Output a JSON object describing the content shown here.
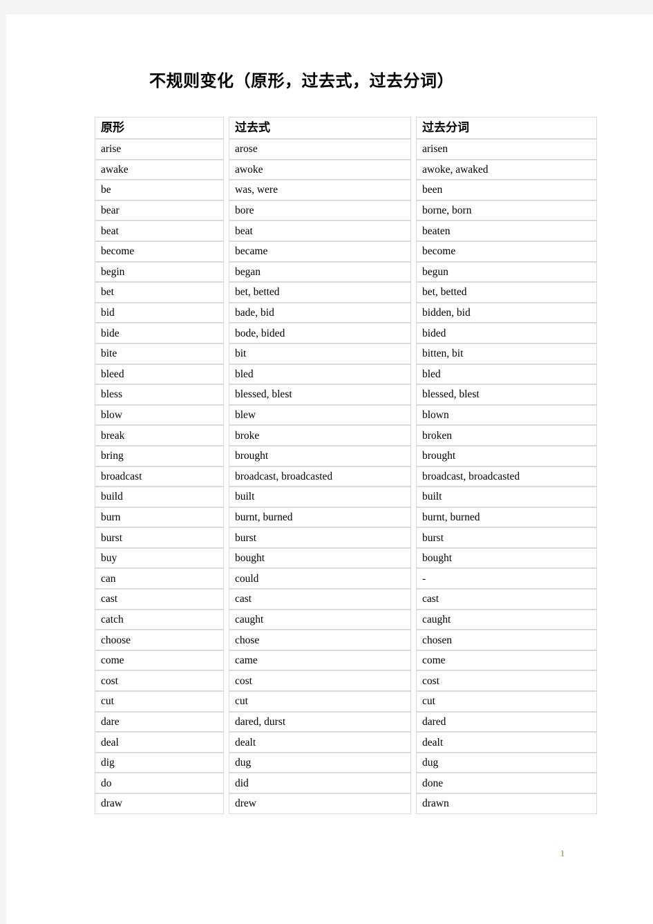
{
  "document": {
    "title": "不规则变化（原形，过去式，过去分词）",
    "page_number": "1",
    "page_number_color": "#9a8020",
    "background_color": "#f4f4f4",
    "page_color": "#ffffff",
    "border_color": "#d9d9d9"
  },
  "table": {
    "headers": [
      "原形",
      "过去式",
      "过去分词"
    ],
    "rows": [
      [
        "arise",
        "arose",
        "arisen"
      ],
      [
        "awake",
        "awoke",
        "awoke, awaked"
      ],
      [
        "be",
        "was, were",
        "been"
      ],
      [
        "bear",
        "bore",
        "borne, born"
      ],
      [
        "beat",
        "beat",
        "beaten"
      ],
      [
        "become",
        "became",
        "become"
      ],
      [
        "begin",
        "began",
        "begun"
      ],
      [
        "bet",
        "bet, betted",
        "bet, betted"
      ],
      [
        "bid",
        "bade, bid",
        "bidden, bid"
      ],
      [
        "bide",
        "bode, bided",
        "bided"
      ],
      [
        "bite",
        "bit",
        "bitten, bit"
      ],
      [
        "bleed",
        "bled",
        "bled"
      ],
      [
        "bless",
        "blessed, blest",
        "blessed, blest"
      ],
      [
        "blow",
        "blew",
        "blown"
      ],
      [
        "break",
        "broke",
        "broken"
      ],
      [
        "bring",
        "brought",
        "brought"
      ],
      [
        "broadcast",
        "broadcast, broadcasted",
        "broadcast, broadcasted"
      ],
      [
        "build",
        "built",
        "built"
      ],
      [
        "burn",
        "burnt, burned",
        "burnt, burned"
      ],
      [
        "burst",
        "burst",
        "burst"
      ],
      [
        "buy",
        "bought",
        "bought"
      ],
      [
        "can",
        "could",
        "-"
      ],
      [
        "cast",
        "cast",
        "cast"
      ],
      [
        "catch",
        "caught",
        "caught"
      ],
      [
        "choose",
        "chose",
        "chosen"
      ],
      [
        "come",
        "came",
        "come"
      ],
      [
        "cost",
        "cost",
        "cost"
      ],
      [
        "cut",
        "cut",
        "cut"
      ],
      [
        "dare",
        "dared, durst",
        "dared"
      ],
      [
        "deal",
        "dealt",
        "dealt"
      ],
      [
        "dig",
        "dug",
        "dug"
      ],
      [
        "do",
        "did",
        "done"
      ],
      [
        "draw",
        "drew",
        "drawn"
      ]
    ]
  }
}
